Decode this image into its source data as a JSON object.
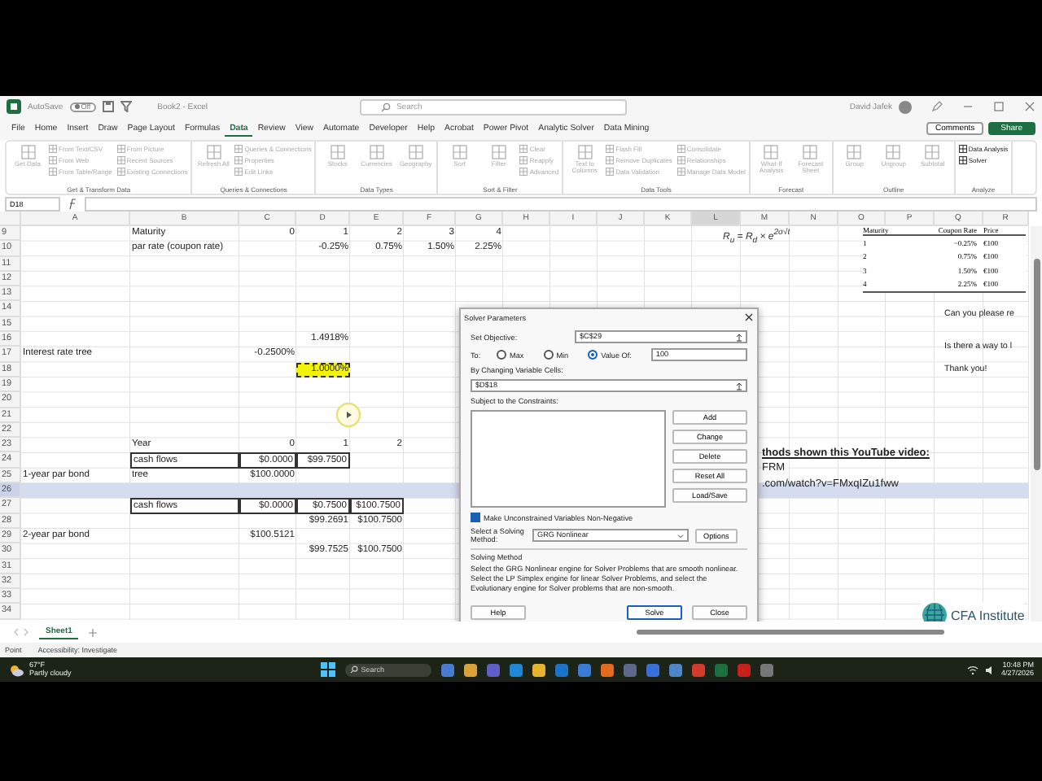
{
  "title_bar": {
    "autosave_label": "AutoSave",
    "autosave_state": "Off",
    "autosave_on": false,
    "document_title": "Book2 - Excel",
    "search_placeholder": "Search",
    "user_name": "David Jafek"
  },
  "menu_tabs": [
    {
      "label": "File",
      "selected": false
    },
    {
      "label": "Home",
      "selected": false
    },
    {
      "label": "Insert",
      "selected": false
    },
    {
      "label": "Draw",
      "selected": false
    },
    {
      "label": "Page Layout",
      "selected": false
    },
    {
      "label": "Formulas",
      "selected": false
    },
    {
      "label": "Data",
      "selected": true
    },
    {
      "label": "Review",
      "selected": false
    },
    {
      "label": "View",
      "selected": false
    },
    {
      "label": "Automate",
      "selected": false
    },
    {
      "label": "Developer",
      "selected": false
    },
    {
      "label": "Help",
      "selected": false
    },
    {
      "label": "Acrobat",
      "selected": false
    },
    {
      "label": "Power Pivot",
      "selected": false
    },
    {
      "label": "Analytic Solver",
      "selected": false
    },
    {
      "label": "Data Mining",
      "selected": false
    }
  ],
  "comments_button": "Comments",
  "share_button": "Share",
  "ribbon_groups": [
    {
      "label": "Get & Transform Data",
      "items": [
        {
          "label": "Get Data",
          "kind": "large",
          "disabled": true
        },
        {
          "label": "From Text/CSV",
          "kind": "small",
          "disabled": true
        },
        {
          "label": "From Web",
          "kind": "small",
          "disabled": true
        },
        {
          "label": "From Table/Range",
          "kind": "small",
          "disabled": true
        },
        {
          "label": "From Picture",
          "kind": "small",
          "disabled": true
        },
        {
          "label": "Recent Sources",
          "kind": "small",
          "disabled": true
        },
        {
          "label": "Existing Connections",
          "kind": "small",
          "disabled": true
        }
      ]
    },
    {
      "label": "Queries & Connections",
      "items": [
        {
          "label": "Refresh All",
          "kind": "large",
          "disabled": true
        },
        {
          "label": "Queries & Connections",
          "kind": "small",
          "disabled": true
        },
        {
          "label": "Properties",
          "kind": "small",
          "disabled": true
        },
        {
          "label": "Edit Links",
          "kind": "small",
          "disabled": true
        }
      ]
    },
    {
      "label": "Data Types",
      "items": [
        {
          "label": "Stocks",
          "kind": "large",
          "disabled": true
        },
        {
          "label": "Currencies",
          "kind": "large",
          "disabled": true
        },
        {
          "label": "Geography",
          "kind": "large",
          "disabled": true
        }
      ]
    },
    {
      "label": "Sort & Filter",
      "items": [
        {
          "label": "Sort",
          "kind": "large",
          "disabled": true
        },
        {
          "label": "Filter",
          "kind": "large",
          "disabled": true
        },
        {
          "label": "Clear",
          "kind": "small",
          "disabled": true
        },
        {
          "label": "Reapply",
          "kind": "small",
          "disabled": true
        },
        {
          "label": "Advanced",
          "kind": "small",
          "disabled": true
        }
      ]
    },
    {
      "label": "Data Tools",
      "items": [
        {
          "label": "Text to Columns",
          "kind": "large",
          "disabled": true
        },
        {
          "label": "Flash Fill",
          "kind": "small",
          "disabled": true
        },
        {
          "label": "Remove Duplicates",
          "kind": "small",
          "disabled": true
        },
        {
          "label": "Data Validation",
          "kind": "small",
          "disabled": true
        },
        {
          "label": "Consolidate",
          "kind": "small",
          "disabled": true
        },
        {
          "label": "Relationships",
          "kind": "small",
          "disabled": true
        },
        {
          "label": "Manage Data Model",
          "kind": "small",
          "disabled": true
        }
      ]
    },
    {
      "label": "Forecast",
      "items": [
        {
          "label": "What-If Analysis",
          "kind": "large",
          "disabled": true
        },
        {
          "label": "Forecast Sheet",
          "kind": "large",
          "disabled": true
        }
      ]
    },
    {
      "label": "Outline",
      "items": [
        {
          "label": "Group",
          "kind": "large",
          "disabled": true
        },
        {
          "label": "Ungroup",
          "kind": "large",
          "disabled": true
        },
        {
          "label": "Subtotal",
          "kind": "large",
          "disabled": true
        }
      ]
    },
    {
      "label": "Analyze",
      "items": [
        {
          "label": "Data Analysis",
          "kind": "small",
          "disabled": false
        },
        {
          "label": "Solver",
          "kind": "small",
          "disabled": false
        }
      ]
    }
  ],
  "name_box": "D18",
  "columns": [
    {
      "label": "A",
      "selected": false
    },
    {
      "label": "B",
      "selected": false
    },
    {
      "label": "C",
      "selected": false
    },
    {
      "label": "D",
      "selected": false
    },
    {
      "label": "E",
      "selected": false
    },
    {
      "label": "F",
      "selected": false
    },
    {
      "label": "G",
      "selected": false
    },
    {
      "label": "H",
      "selected": false
    },
    {
      "label": "I",
      "selected": false
    },
    {
      "label": "J",
      "selected": false
    },
    {
      "label": "K",
      "selected": false
    },
    {
      "label": "L",
      "selected": true
    },
    {
      "label": "M",
      "selected": false
    },
    {
      "label": "N",
      "selected": false
    },
    {
      "label": "O",
      "selected": false
    },
    {
      "label": "P",
      "selected": false
    },
    {
      "label": "Q",
      "selected": false
    },
    {
      "label": "R",
      "selected": false
    }
  ],
  "rows": [
    {
      "number": "9",
      "selected": false,
      "cells": {
        "B": {
          "text": "Maturity",
          "kind": "text"
        },
        "C": {
          "text": "0",
          "kind": "number"
        },
        "D": {
          "text": "1",
          "kind": "number"
        },
        "E": {
          "text": "2",
          "kind": "number"
        },
        "F": {
          "text": "3",
          "kind": "number"
        },
        "G": {
          "text": "4",
          "kind": "number"
        }
      }
    },
    {
      "number": "10",
      "selected": false,
      "cells": {
        "B": {
          "text": "par rate (coupon rate)",
          "kind": "text"
        },
        "D": {
          "text": "-0.25%",
          "kind": "number"
        },
        "E": {
          "text": "0.75%",
          "kind": "number"
        },
        "F": {
          "text": "1.50%",
          "kind": "number"
        },
        "G": {
          "text": "2.25%",
          "kind": "number"
        }
      }
    },
    {
      "number": "11",
      "selected": false,
      "cells": {}
    },
    {
      "number": "12",
      "selected": false,
      "cells": {}
    },
    {
      "number": "13",
      "selected": false,
      "cells": {}
    },
    {
      "number": "14",
      "selected": false,
      "cells": {}
    },
    {
      "number": "15",
      "selected": false,
      "cells": {}
    },
    {
      "number": "16",
      "selected": false,
      "cells": {
        "D": {
          "text": "1.4918%",
          "kind": "number"
        }
      }
    },
    {
      "number": "17",
      "selected": false,
      "cells": {
        "A": {
          "text": "Interest rate tree",
          "kind": "text"
        },
        "C": {
          "text": "-0.2500%",
          "kind": "number"
        }
      }
    },
    {
      "number": "18",
      "selected": false,
      "cells": {
        "D": {
          "text": "1.0000%",
          "kind": "active_number"
        }
      }
    },
    {
      "number": "19",
      "selected": false,
      "cells": {}
    },
    {
      "number": "20",
      "selected": false,
      "cells": {}
    },
    {
      "number": "21",
      "selected": false,
      "cells": {}
    },
    {
      "number": "22",
      "selected": false,
      "cells": {}
    },
    {
      "number": "23",
      "selected": false,
      "cells": {
        "B": {
          "text": "Year",
          "kind": "text"
        },
        "C": {
          "text": "0",
          "kind": "number"
        },
        "D": {
          "text": "1",
          "kind": "number"
        },
        "E": {
          "text": "2",
          "kind": "number"
        }
      }
    },
    {
      "number": "24",
      "selected": false,
      "cells": {
        "B": {
          "text": "cash flows",
          "kind": "boxed_text"
        },
        "C": {
          "text": "$0.0000",
          "kind": "boxed_number"
        },
        "D": {
          "text": "$99.7500",
          "kind": "boxed_number"
        }
      }
    },
    {
      "number": "25",
      "selected": false,
      "cells": {
        "A": {
          "text": "1-year par bond",
          "kind": "text"
        },
        "B": {
          "text": "tree",
          "kind": "text"
        },
        "C": {
          "text": "$100.0000",
          "kind": "number"
        }
      }
    },
    {
      "number": "26",
      "selected": true,
      "cells": {}
    },
    {
      "number": "27",
      "selected": false,
      "cells": {
        "B": {
          "text": "cash flows",
          "kind": "boxed_text"
        },
        "C": {
          "text": "$0.0000",
          "kind": "boxed_number"
        },
        "D": {
          "text": "$0.7500",
          "kind": "boxed_number"
        },
        "E": {
          "text": "$100.7500",
          "kind": "boxed_number"
        }
      }
    },
    {
      "number": "28",
      "selected": false,
      "cells": {
        "D": {
          "text": "$99.2691",
          "kind": "number"
        },
        "E": {
          "text": "$100.7500",
          "kind": "number"
        }
      }
    },
    {
      "number": "29",
      "selected": false,
      "cells": {
        "A": {
          "text": "2-year par bond",
          "kind": "text"
        },
        "C": {
          "text": "$100.5121",
          "kind": "number"
        }
      }
    },
    {
      "number": "30",
      "selected": false,
      "cells": {
        "D": {
          "text": "$99.7525",
          "kind": "number"
        },
        "E": {
          "text": "$100.7500",
          "kind": "number"
        }
      }
    },
    {
      "number": "31",
      "selected": false,
      "cells": {}
    },
    {
      "number": "32",
      "selected": false,
      "cells": {}
    },
    {
      "number": "33",
      "selected": false,
      "cells": {}
    },
    {
      "number": "34",
      "selected": false,
      "cells": {}
    }
  ],
  "formula_note": "R$_{u}$ = R$_{d}$ × e$^{2σ√t}$",
  "price_table": {
    "columns": [
      "Maturity",
      "Coupon Rate",
      "Price"
    ],
    "rows": [
      [
        "1",
        "−0.25%",
        "€100"
      ],
      [
        "2",
        "0.75%",
        "€100"
      ],
      [
        "3",
        "1.50%",
        "€100"
      ],
      [
        "4",
        "2.25%",
        "€100"
      ]
    ]
  },
  "notes": [
    "Can you please re",
    "Is there a way to l",
    "Thank you!"
  ],
  "video_note": {
    "heading": "thods shown this YouTube video:",
    "lines": [
      "FRM",
      ".com/watch?v=FMxqIZu1fww"
    ]
  },
  "logo_text": "CFA Institute",
  "solver": {
    "title": "Solver Parameters",
    "objective_label": "Set Objective:",
    "objective": "$C$29",
    "to_label": "To:",
    "targets": [
      {
        "label": "Max",
        "selected": false
      },
      {
        "label": "Min",
        "selected": false
      },
      {
        "label": "Value Of:",
        "selected": true
      }
    ],
    "value_of": "100",
    "changing_label": "By Changing Variable Cells:",
    "changing": "$D$18",
    "constraints_label": "Subject to the Constraints:",
    "side_buttons": [
      "Add",
      "Change",
      "Delete",
      "Reset All",
      "Load/Save"
    ],
    "nonnegative": {
      "label": "Make Unconstrained Variables Non-Negative",
      "checked": true
    },
    "method_label": "Select a Solving Method:",
    "method": "GRG Nonlinear",
    "options_button": "Options",
    "group_label": "Solving Method",
    "description": "Select the GRG Nonlinear engine for Solver Problems that are smooth nonlinear. Select the LP Simplex engine for linear Solver Problems, and select the Evolutionary engine for Solver problems that are non-smooth.",
    "buttons": [
      "Help",
      "Solve",
      "Close"
    ]
  },
  "sheet_tabs": [
    {
      "label": "Sheet1",
      "selected": true
    }
  ],
  "status_bar": {
    "mode": "Point",
    "accessibility": "Accessibility: Investigate"
  },
  "taskbar": {
    "temperature": "67°F",
    "weather": "Partly cloudy",
    "search_placeholder": "Search",
    "time": "10:48 PM",
    "date": "4/27/2026"
  }
}
